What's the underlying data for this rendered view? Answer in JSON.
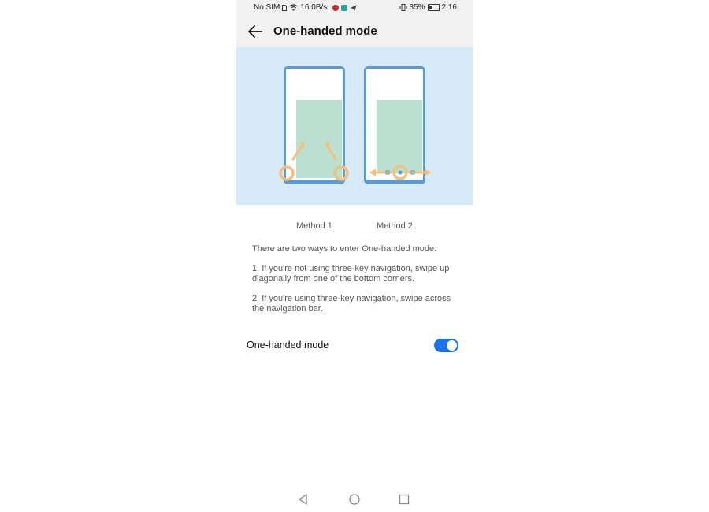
{
  "status_bar": {
    "carrier": "No SIM",
    "speed": "16.0B/s",
    "battery": "35%",
    "time": "2:16",
    "app_icon_colors": [
      "#c62828",
      "#26a69a",
      "#444444"
    ]
  },
  "header": {
    "title": "One-handed mode",
    "back_icon": "arrow-left-icon"
  },
  "illustration": {
    "background": "#d6eaf8",
    "phone_frame_color": "#5a9bd5",
    "screen_color": "#b9e0d0",
    "gesture_color": "#f5c07a"
  },
  "methods": {
    "method_1": "Method 1",
    "method_2": "Method 2"
  },
  "description": {
    "intro": "There are two ways to enter One-handed mode:",
    "item_1": "1. If you're not using three-key navigation, swipe up diagonally from one of the bottom corners.",
    "item_2": "2. If you're using three-key navigation, swipe across the navigation bar."
  },
  "setting": {
    "label": "One-handed mode",
    "enabled": true,
    "accent": "#1a73e8"
  },
  "navigation_bar": {
    "icons": [
      "back-triangle-icon",
      "home-circle-icon",
      "recents-square-icon"
    ]
  }
}
